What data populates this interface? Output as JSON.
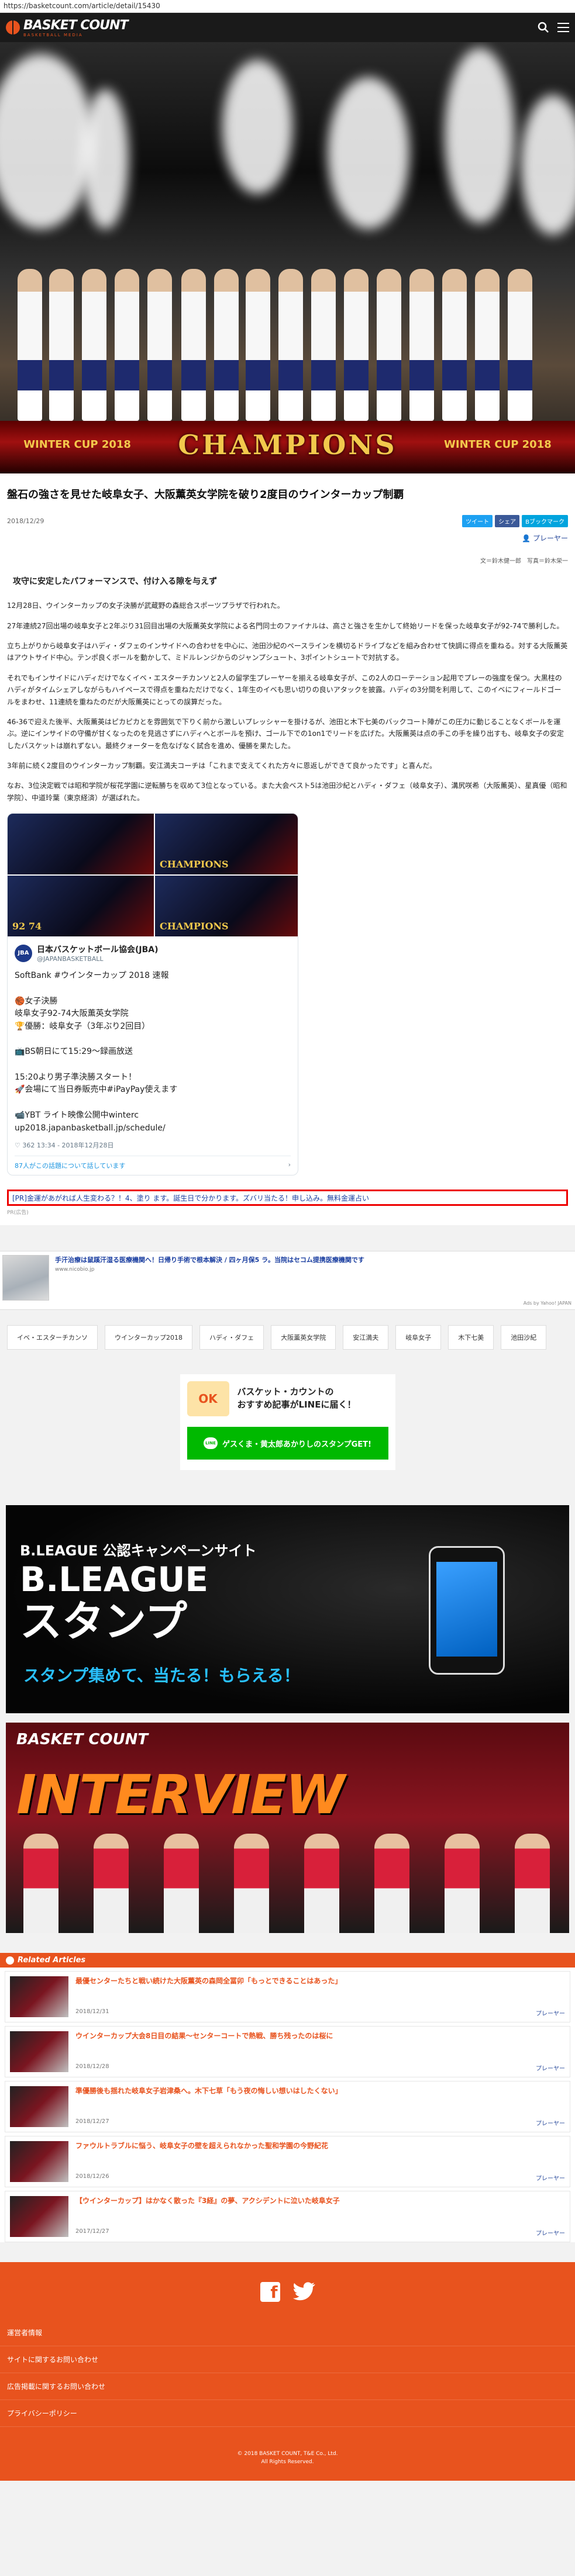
{
  "browser": {
    "url": "https://basketcount.com/article/detail/15430"
  },
  "header": {
    "logo_main": "BASKET COUNT",
    "logo_sub": "BASKETBALL MEDIA",
    "search_icon": "search-icon",
    "menu_icon": "hamburger-menu-icon"
  },
  "hero": {
    "left_logo": "WINTER CUP 2018",
    "center_word": "CHAMPIONS",
    "right_logo": "WINTER CUP 2018"
  },
  "article": {
    "title": "盤石の強さを見せた岐阜女子、大阪薫英女学院を破り2度目のウインターカップ制覇",
    "date": "2018/12/29",
    "share": {
      "tweet": "ツイート",
      "share": "シェア",
      "bookmark": "Bブックマーク"
    },
    "player_link": "プレーヤー",
    "credit": "文＝鈴木健一郎　写真＝鈴木栄一",
    "lead": "攻守に安定したパフォーマンスで、付け入る隙を与えず",
    "paragraphs": [
      "12月28日、ウインターカップの女子決勝が武蔵野の森総合スポーツプラザで行われた。",
      "27年連続27回出場の岐阜女子と2年ぶり31回目出場の大阪薫英女学院による名門同士のファイナルは、高さと強さを生かして終始リードを保った岐阜女子が92-74で勝利した。",
      "立ち上がりから岐阜女子はハディ・ダフェのインサイドへの合わせを中心に、池田沙紀のペースラインを横切るドライブなどを組み合わせて快調に得点を重ねる。対する大阪薫英はアウトサイド中心。テンポ良くボールを動かして、ミドルレンジからのジャンプシュート、3ポイントシュートで対抗する。",
      "それでもインサイドにハディだけでなくイベ・エスターチカンソと2人の留学生プレーヤーを揃える岐阜女子が、この2人のローテーション起用でプレーの強度を保つ。大黒柱のハディがタイムシェアしながらもハイペースで得点を重ねただけでなく、1年生のイベも思い切りの良いアタックを披露。ハディの3分間を利用して、このイベにフィールドゴールをまわせ、11連続を重ねたのだが大阪薫英にとっての誤算だった。",
      "46-36で迎えた後半、大阪薫英はピカピカとを雰囲気で下りく前から激しいプレッシャーを掛けるが、池田と木下七美のバックコート陣がこの圧力に動じることなくボールを運ぶ。逆にインサイドの守備が甘くなったのを見逃さずにハディへとボールを預け、ゴール下での1on1でリードを広げた。大阪薫英は点の手この手を繰り出すも、岐阜女子の安定したバスケットは崩れずない。最終クォーターを危なげなく試合を進め、優勝を果たした。",
      "3年前に続く2度目のウインターカップ制覇。安江満夫コーチは「これまで支えてくれた方々に恩返しができて良かったです」と喜んだ。",
      "なお、3位決定戦では昭和学院が桜花学園に逆転勝ちを収めて3位となっている。また大会ベスト5は池田沙紀とハディ・ダフェ（岐阜女子）、溝尻咲希（大阪薫英）、星真優（昭和学院）、中道玲葉（東京経済）が選ばれた。"
    ],
    "tweet": {
      "image_labels": [
        "CHAMPIONS",
        "92 74",
        "",
        "CHAMPIONS"
      ],
      "avatar": "JBA",
      "name": "日本バスケットボール協会(JBA)",
      "handle": "@JAPANBASKETBALL",
      "text": "SoftBank #ウインターカップ 2018 速報\n\n🏀女子決勝\n岐阜女子92-74大阪薫英女学院\n🏆優勝：岐阜女子（3年ぶり2回目）\n\n📺BS朝日にて15:29〜録画放送\n\n15:20より男子準決勝スタート！\n🚀会場にて当日券販売中#iPayPay使えます\n\n📹YBT ライト映像公開中winterc up2018.japanbasketball.jp/schedule/",
      "time": "13:34 - 2018年12月28日",
      "likes": "362",
      "info": "87人がこの話題について話しています"
    },
    "promo": "[PR]金運があがれば人生変わる？！4、塗り ます。誕生日で分かります。ズバリ当たる！申し込み。無料金運占い",
    "pr_label": "PR(広告)"
  },
  "ads": {
    "title": "手汗治療は鼠蹊汗湿る医療機関へ！日帰り手術で根本解決 / 四ヶ月保5 ラ。当院はセコム提携医療機関です",
    "source": "www.nicobio.jp",
    "ads_by": "Ads by Yahoo! JAPAN"
  },
  "tags": [
    "イベ・エスターチカンソ",
    "ウインターカップ2018",
    "ハディ・ダフェ",
    "大阪薫英女学院",
    "安江満夫",
    "岐阜女子",
    "木下七美",
    "池田沙紀"
  ],
  "line_box": {
    "badge": "OK",
    "message": "バスケット・カウントの\nおすすめ記事がLINEに届く！",
    "button": "ゲスくま・黄太郎あかりしのスタンプGET!",
    "button_icon": "LINE"
  },
  "stamp_banner": {
    "campaign": "B.LEAGUE 公認キャンペーンサイト",
    "big_line1": "B.LEAGUE",
    "big_line2": "スタンプ",
    "tagline": "スタンプ集めて、当たる！もらえる！"
  },
  "interview_banner": {
    "logo": "BASKET COUNT",
    "word": "INTERVIEW"
  },
  "related": {
    "heading": "Related Articles",
    "items": [
      {
        "title": "最優センターたちと戦い続けた大阪薫英の森岡全冨卯「もっとできることはあった」",
        "date": "2018/12/31",
        "player": "プレーヤー"
      },
      {
        "title": "ウインターカップ大会8日目の結果〜センターコートで熱戦、勝ち残ったのは桜に",
        "date": "2018/12/28",
        "player": "プレーヤー"
      },
      {
        "title": "準優勝後も揺れた岐阜女子岩津桑へ。木下七草「もう夜の悔しい想いはしたくない」",
        "date": "2018/12/27",
        "player": "プレーヤー"
      },
      {
        "title": "ファウルトラブルに悩う、岐阜女子の壁を超えられなかった聖和学園の今野紀花",
        "date": "2018/12/26",
        "player": "プレーヤー"
      },
      {
        "title": "【ウインターカップ】はかなく散った『3経』の夢、アクシデントに泣いた岐阜女子",
        "date": "2017/12/27",
        "player": "プレーヤー"
      }
    ]
  },
  "footer": {
    "links": [
      "運営者情報",
      "サイトに関するお問い合わせ",
      "広告掲載に関するお問い合わせ",
      "プライバシーポリシー"
    ],
    "copyright": "© 2018 BASKET COUNT, T&E Co., Ltd.\nAll Rights Reserved."
  }
}
